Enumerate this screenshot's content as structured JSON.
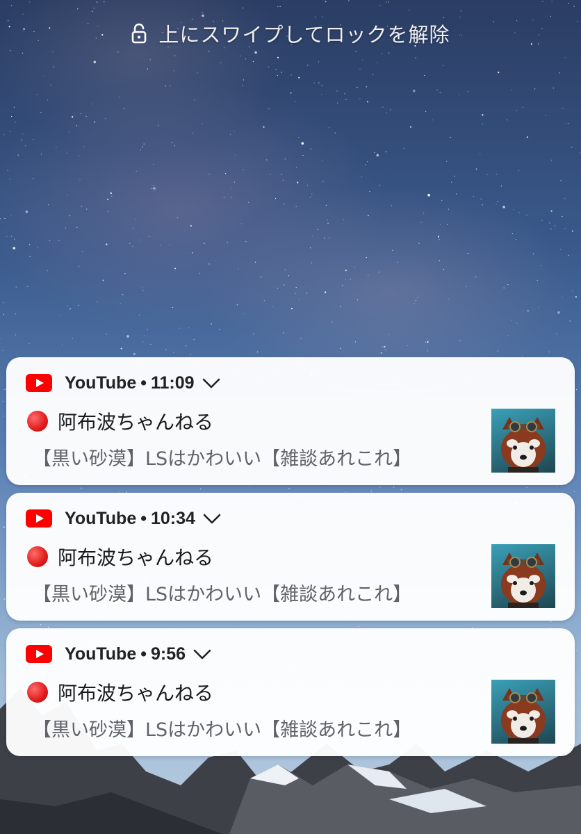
{
  "lock_screen": {
    "unlock_hint": "上にスワイプしてロックを解除"
  },
  "notifications": [
    {
      "app": "YouTube",
      "separator": "•",
      "time": "11:09",
      "title": "阿布波ちゃんねる",
      "text": "【黒い砂漠】LSはかわいい【雑談あれこれ】"
    },
    {
      "app": "YouTube",
      "separator": "•",
      "time": "10:34",
      "title": "阿布波ちゃんねる",
      "text": "【黒い砂漠】LSはかわいい【雑談あれこれ】"
    },
    {
      "app": "YouTube",
      "separator": "•",
      "time": "9:56",
      "title": "阿布波ちゃんねる",
      "text": "【黒い砂漠】LSはかわいい【雑談あれこれ】"
    }
  ],
  "colors": {
    "youtube_red": "#ff0000",
    "live_dot": "#e01b1b"
  },
  "icons": [
    "unlock-icon",
    "youtube-icon",
    "chevron-down-icon",
    "live-indicator-icon"
  ]
}
